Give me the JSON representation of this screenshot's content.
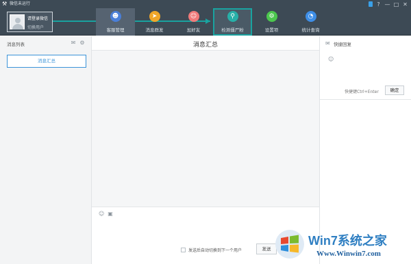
{
  "app": {
    "title": "微信未运行"
  },
  "account": {
    "name": "请登录微信",
    "switch_label": "切换用户"
  },
  "nav": {
    "items": [
      {
        "label": "客服管理",
        "icon": "customer-service-icon",
        "color": "#4a7fd8"
      },
      {
        "label": "消息群发",
        "icon": "paper-plane-icon",
        "color": "#f0a629"
      },
      {
        "label": "加好友",
        "icon": "add-friend-icon",
        "color": "#f07a7a"
      },
      {
        "label": "检测僵尸粉",
        "icon": "scan-icon",
        "color": "#27b0a8"
      },
      {
        "label": "设置项",
        "icon": "gear-icon",
        "color": "#4cc74e"
      },
      {
        "label": "统计查询",
        "icon": "pie-chart-icon",
        "color": "#3e8ee6"
      }
    ]
  },
  "sidebar": {
    "title": "消息列表",
    "summary_button": "消息汇总"
  },
  "main": {
    "title": "消息汇总",
    "auto_switch_label": "发送后自动切换到下一个用户",
    "send_label": "发送"
  },
  "right_panel": {
    "title": "快捷回复",
    "shortcut_hint": "快捷键Ctrl+Enter",
    "confirm_label": "确定"
  },
  "watermark": {
    "title": "Win7系统之家",
    "url": "Www.Winwin7.com"
  },
  "colors": {
    "accent": "#19a3a0",
    "header_bg": "#3d4a55",
    "link_blue": "#3a93d8"
  }
}
